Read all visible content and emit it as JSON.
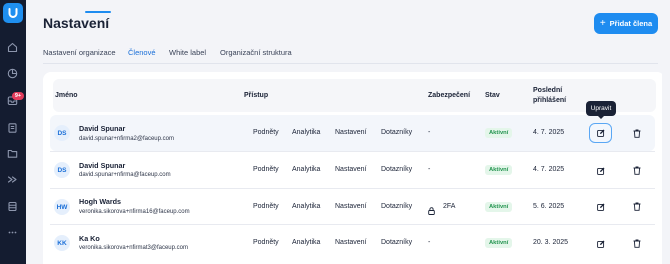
{
  "page": {
    "title": "Nastavení",
    "add_button_label": "Přidat člena"
  },
  "sidebar": {
    "items": [
      {
        "icon": "logo-icon"
      },
      {
        "icon": "home-icon"
      },
      {
        "icon": "chart-icon"
      },
      {
        "icon": "inbox-icon",
        "badge": "9+"
      },
      {
        "icon": "clipboard-icon"
      },
      {
        "icon": "folder-icon"
      },
      {
        "icon": "arrows-icon"
      },
      {
        "icon": "database-icon"
      },
      {
        "icon": "more-icon"
      }
    ]
  },
  "tabs": [
    {
      "label": "Nastavení organizace",
      "active": false
    },
    {
      "label": "Členové",
      "active": true
    },
    {
      "label": "White label",
      "active": false
    },
    {
      "label": "Organizační struktura",
      "active": false
    }
  ],
  "table": {
    "headers": {
      "name": "Jméno",
      "access": "Přístup",
      "security": "Zabezpečení",
      "status": "Stav",
      "last_login_line1": "Poslední",
      "last_login_line2": "přihlášení"
    },
    "rows": [
      {
        "initials": "DS",
        "name": "David Spunar",
        "email": "david.spunar+nfirma2@faceup.com",
        "access": [
          "Podněty",
          "Analytika",
          "Nastavení",
          "Dotazníky"
        ],
        "security": "-",
        "status": "Aktivní",
        "last_login": "4. 7. 2025"
      },
      {
        "initials": "DS",
        "name": "David Spunar",
        "email": "david.spunar+nfirma@faceup.com",
        "access": [
          "Podněty",
          "Analytika",
          "Nastavení",
          "Dotazníky"
        ],
        "security": "-",
        "status": "Aktivní",
        "last_login": "4. 7. 2025"
      },
      {
        "initials": "HW",
        "name": "Hogh Wards",
        "email": "veronika.sikorova+nfirma16@faceup.com",
        "access": [
          "Podněty",
          "Analytika",
          "Nastavení",
          "Dotazníky"
        ],
        "security": "2FA",
        "status": "Aktivní",
        "last_login": "5. 6. 2025"
      },
      {
        "initials": "KK",
        "name": "Ka Ko",
        "email": "veronika.sikorova+nfirmat3@faceup.com",
        "access": [
          "Podněty",
          "Analytika",
          "Nastavení",
          "Dotazníky"
        ],
        "security": "-",
        "status": "Aktivní",
        "last_login": "20. 3. 2025"
      }
    ]
  },
  "tooltip": "Upravit",
  "colors": {
    "sidebar": "#141c30",
    "accent": "#1e8cf0",
    "status_bg": "#e4f6ea",
    "status_text": "#23944f",
    "badge": "#e23c5c"
  }
}
